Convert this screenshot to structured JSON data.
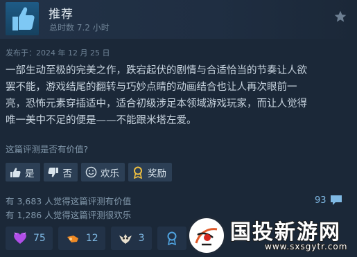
{
  "header": {
    "recommendation": "推荐",
    "hours": "总时数 7.2 小时",
    "icon": "thumbs-up-icon",
    "badge_icon": "star-icon"
  },
  "review": {
    "posted": "发布于：2024 年 12 月 25 日",
    "lines": [
      "一部生动至极的完美之作，跌宕起伏的剧情与合适恰当的节奏让人欲",
      "罢不能，游戏结尾的翻转与巧妙点睛的动画结合也让人再次眼前一",
      "亮，恐怖元素穿插适中，适合初级涉足本领域游戏玩家，而让人觉得",
      "唯一美中不足的便是——不能跟米塔左爱。"
    ]
  },
  "helpful": {
    "question": "这篇评测是否有价值?",
    "buttons": [
      "是",
      "否",
      "欢乐",
      "奖励"
    ]
  },
  "stats": {
    "helpful_count": "有 3,683 人觉得这篇评测有价值",
    "funny_count": "有 1,286 人觉得这篇评测很欢乐",
    "comments": "93"
  },
  "awards": [
    {
      "icon": "purple-heart-icon",
      "count": "75"
    },
    {
      "icon": "orange-award-icon",
      "count": "12"
    },
    {
      "icon": "owl-award-icon",
      "count": "3"
    }
  ],
  "watermark": {
    "text": "国投新游网",
    "url": "www.sxsgytr.com"
  }
}
